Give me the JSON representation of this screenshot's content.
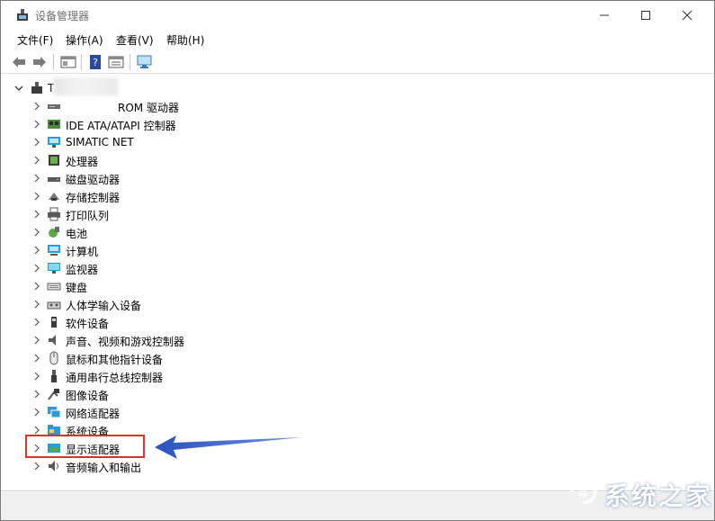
{
  "window": {
    "title": "设备管理器"
  },
  "menu": [
    "文件(F)",
    "操作(A)",
    "查看(V)",
    "帮助(H)"
  ],
  "tree": {
    "root_label": "T",
    "items": [
      {
        "label": "ROM 驱动器",
        "icon": "dvd-drive-icon"
      },
      {
        "label": "IDE ATA/ATAPI 控制器",
        "icon": "ide-controller-icon"
      },
      {
        "label": "SIMATIC NET",
        "icon": "network-monitor-icon"
      },
      {
        "label": "处理器",
        "icon": "processor-icon"
      },
      {
        "label": "磁盘驱动器",
        "icon": "disk-drive-icon"
      },
      {
        "label": "存储控制器",
        "icon": "storage-controller-icon"
      },
      {
        "label": "打印队列",
        "icon": "printer-icon"
      },
      {
        "label": "电池",
        "icon": "battery-icon"
      },
      {
        "label": "计算机",
        "icon": "computer-icon"
      },
      {
        "label": "监视器",
        "icon": "monitor-icon"
      },
      {
        "label": "键盘",
        "icon": "keyboard-icon"
      },
      {
        "label": "人体学输入设备",
        "icon": "hid-icon"
      },
      {
        "label": "软件设备",
        "icon": "software-device-icon"
      },
      {
        "label": "声音、视频和游戏控制器",
        "icon": "sound-icon"
      },
      {
        "label": "鼠标和其他指针设备",
        "icon": "mouse-icon"
      },
      {
        "label": "通用串行总线控制器",
        "icon": "usb-icon"
      },
      {
        "label": "图像设备",
        "icon": "camera-icon"
      },
      {
        "label": "网络适配器",
        "icon": "network-adapter-icon"
      },
      {
        "label": "系统设备",
        "icon": "system-devices-icon"
      },
      {
        "label": "显示适配器",
        "icon": "display-adapter-icon"
      },
      {
        "label": "音频输入和输出",
        "icon": "audio-io-icon"
      }
    ]
  },
  "watermark": {
    "text": "系统之家"
  },
  "colors": {
    "highlight": "#d9322c",
    "arrow": "#3a63c8"
  }
}
